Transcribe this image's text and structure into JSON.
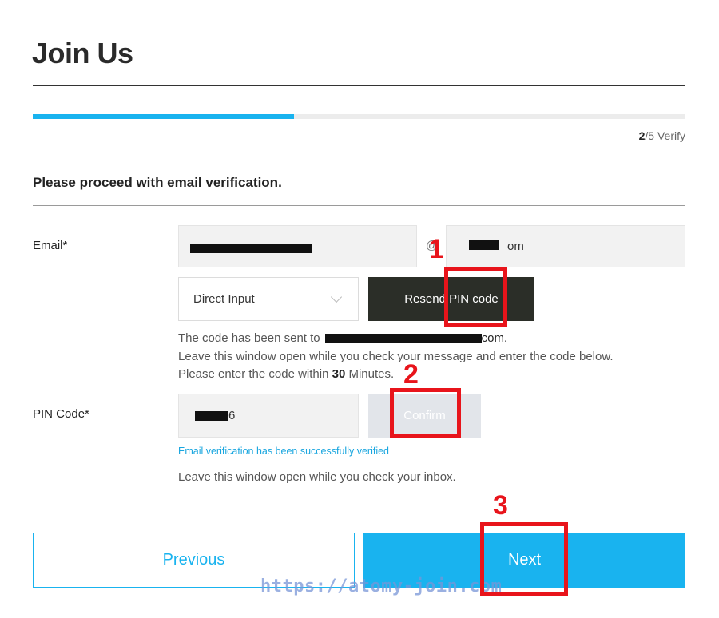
{
  "page": {
    "title": "Join Us",
    "progress_fraction": 0.4,
    "step_current": "2",
    "step_rest": "/5 Verify",
    "subheading": "Please proceed with email verification."
  },
  "email": {
    "label": "Email*",
    "local_value": "",
    "at_sign": "@",
    "domain_suffix": "om",
    "domain_select_value": "Direct Input",
    "resend_label": "Resend PIN code",
    "info_sent_prefix": "The code has been sent to",
    "info_sent_suffix": "com.",
    "info_line2": "Leave this window open while you check your message and enter the code below.",
    "info_line3_prefix": "Please enter the code within",
    "info_line3_value": "30",
    "info_line3_suffix": "Minutes."
  },
  "pin": {
    "label": "PIN Code*",
    "value_suffix": "6",
    "confirm_label": "Confirm",
    "success_message": "Email verification has been successfully verified",
    "note": "Leave this window open while you check your inbox."
  },
  "footer": {
    "previous_label": "Previous",
    "next_label": "Next"
  },
  "annotations": {
    "numbers": [
      "1",
      "2",
      "3"
    ],
    "color": "#e8141b"
  },
  "watermark": "https://atomy-join.com",
  "colors": {
    "accent": "#19b3ef",
    "dark_button": "#2b2e28",
    "disabled_button": "#e2e5ea"
  }
}
